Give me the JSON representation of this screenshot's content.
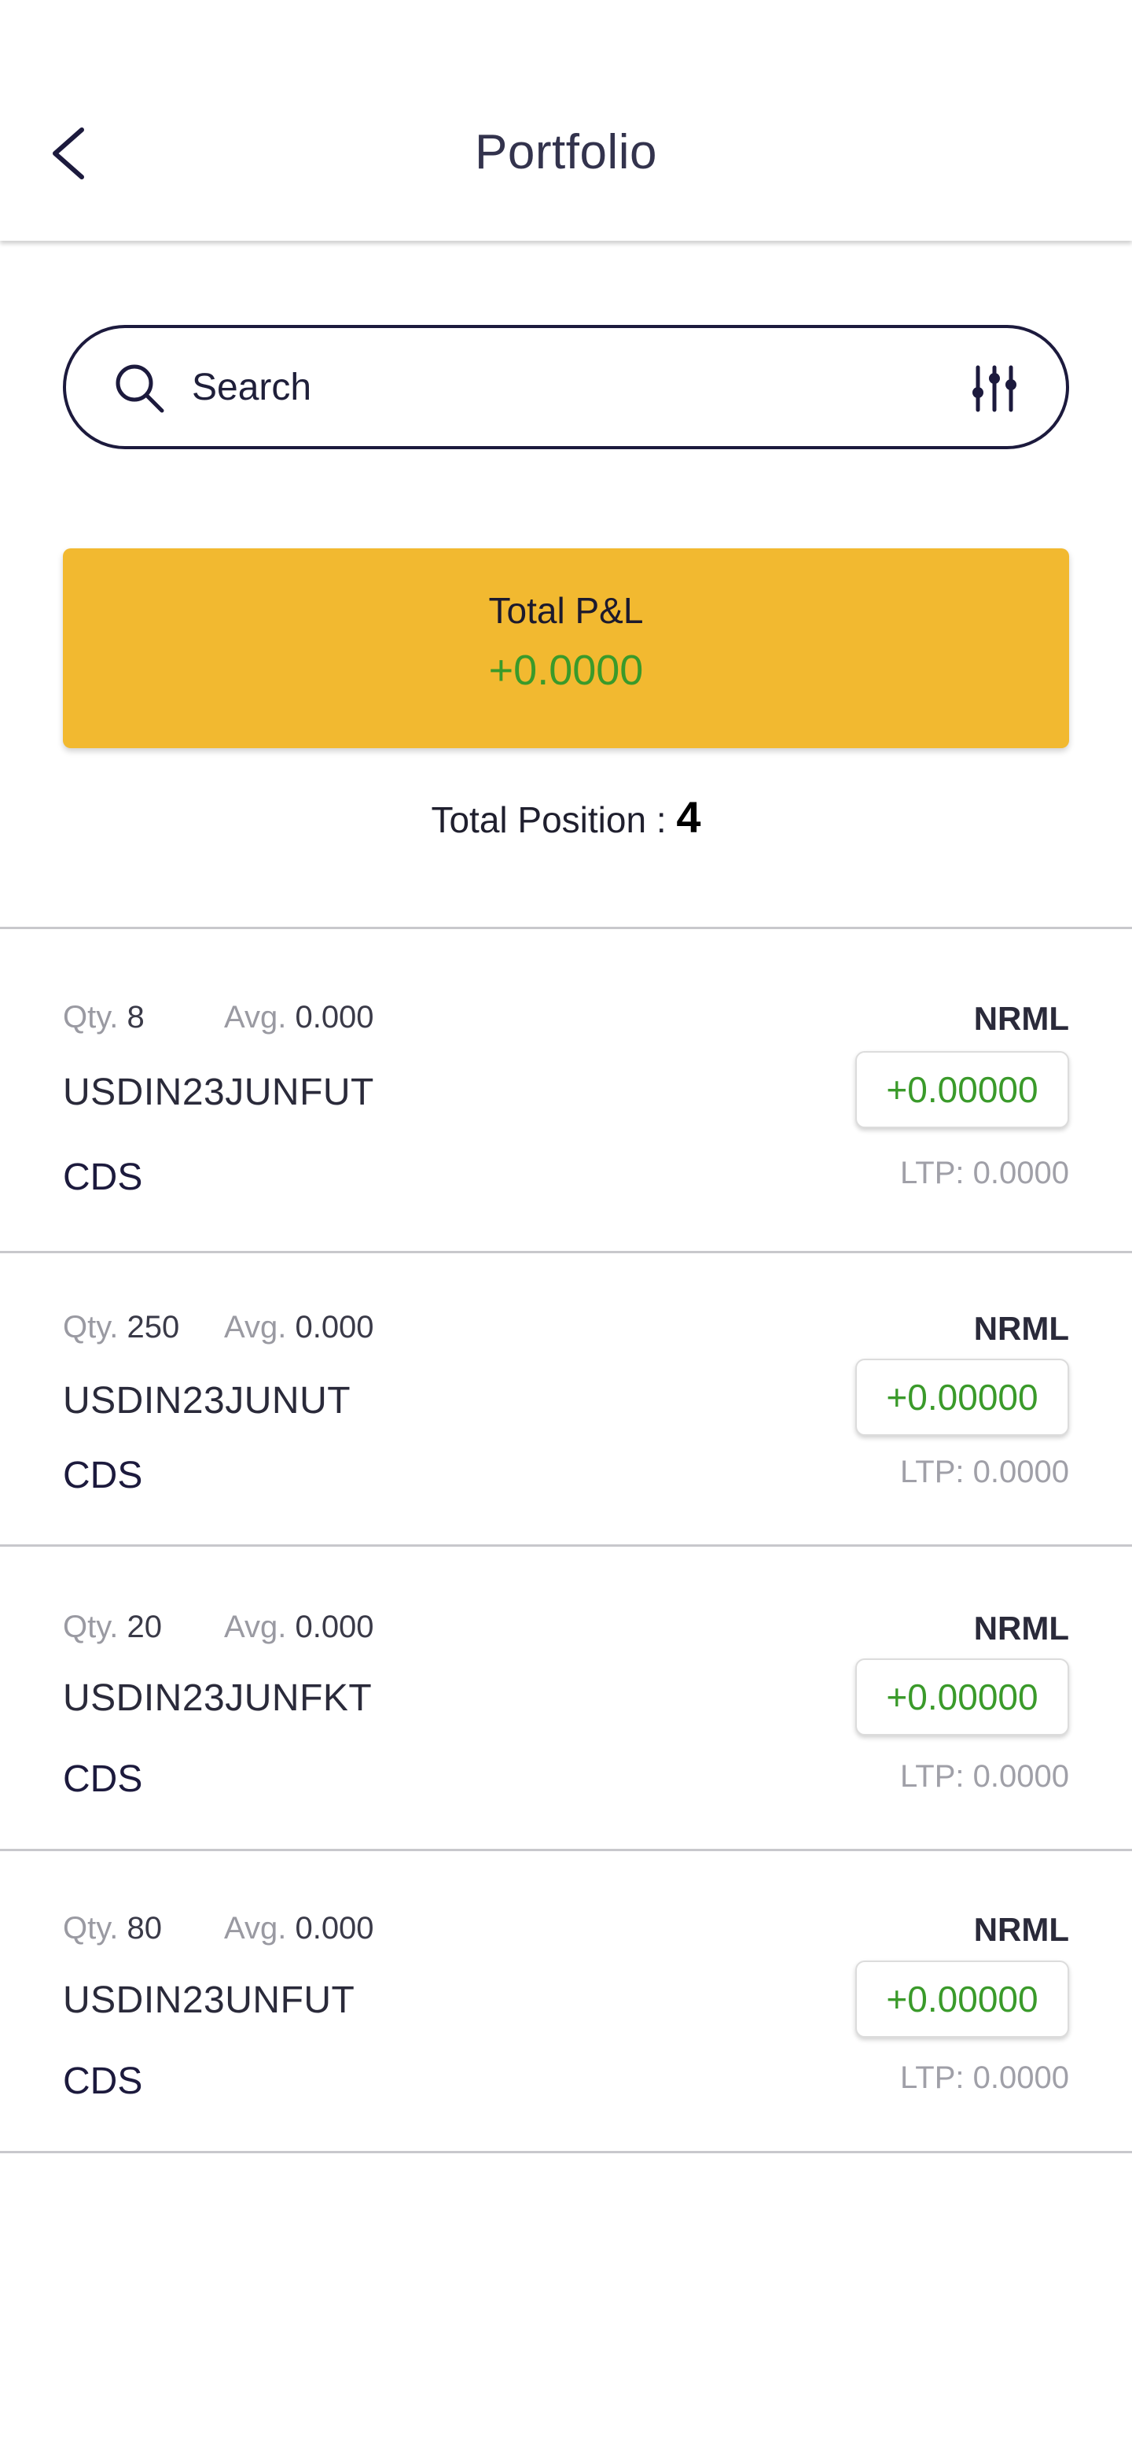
{
  "header": {
    "title": "Portfolio"
  },
  "search": {
    "placeholder": "Search"
  },
  "summary": {
    "pl_label": "Total P&L",
    "pl_value": "+0.0000",
    "total_position_label": "Total Position : ",
    "total_position_count": "4"
  },
  "positions": [
    {
      "qty_label": "Qty.",
      "qty": "8",
      "avg_label": "Avg.",
      "avg": "0.000",
      "symbol": "USDIN23JUNFUT",
      "exchange": "CDS",
      "product": "NRML",
      "pnl": "+0.00000",
      "ltp": "LTP: 0.0000"
    },
    {
      "qty_label": "Qty.",
      "qty": "250",
      "avg_label": "Avg.",
      "avg": "0.000",
      "symbol": "USDIN23JUNUT",
      "exchange": "CDS",
      "product": "NRML",
      "pnl": "+0.00000",
      "ltp": "LTP: 0.0000"
    },
    {
      "qty_label": "Qty.",
      "qty": "20",
      "avg_label": "Avg.",
      "avg": "0.000",
      "symbol": "USDIN23JUNFKT",
      "exchange": "CDS",
      "product": "NRML",
      "pnl": "+0.00000",
      "ltp": "LTP: 0.0000"
    },
    {
      "qty_label": "Qty.",
      "qty": "80",
      "avg_label": "Avg.",
      "avg": "0.000",
      "symbol": "USDIN23UNFUT",
      "exchange": "CDS",
      "product": "NRML",
      "pnl": "+0.00000",
      "ltp": "LTP: 0.0000"
    }
  ],
  "icons": {
    "back": "chevron-left-icon",
    "search": "search-icon",
    "filter": "sliders-icon"
  },
  "colors": {
    "accent": "#f2b930",
    "profit": "#3a9a2a",
    "border": "#1c1a3d"
  }
}
